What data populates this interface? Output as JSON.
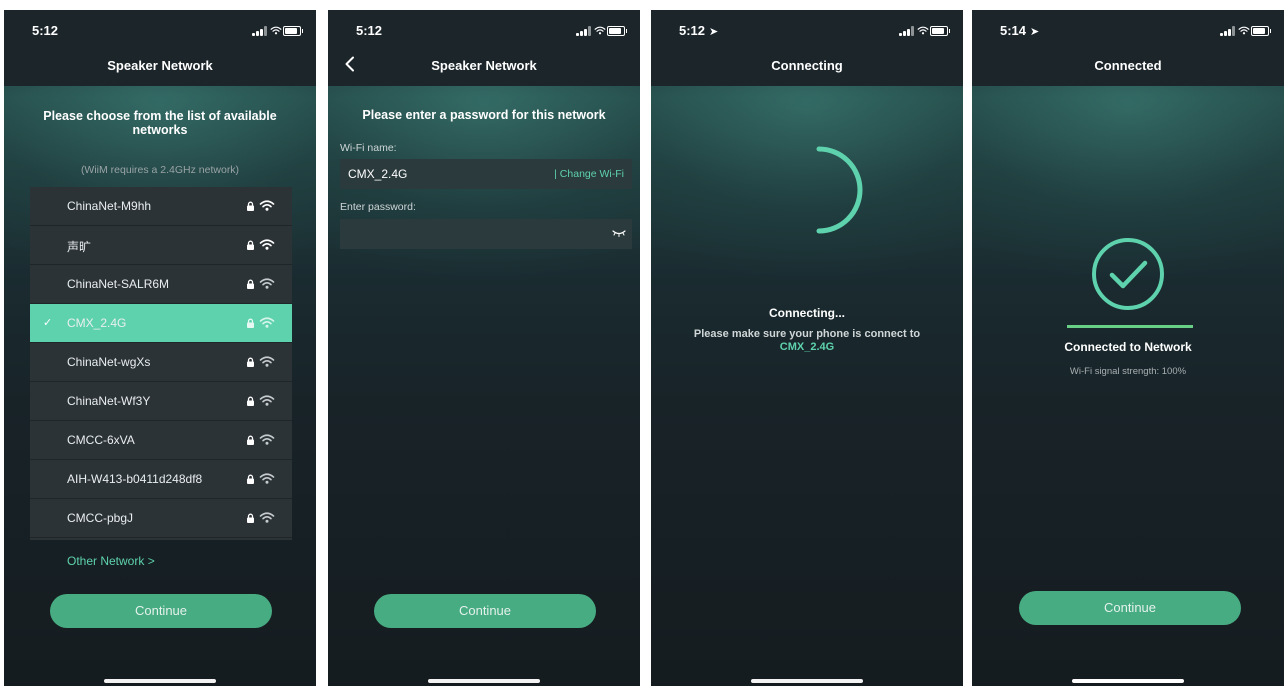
{
  "colors": {
    "accent": "#5ed2ad",
    "button": "#47ac82",
    "list_background": "#2c3337",
    "selected_row": "#5ed2ad",
    "header": "#1b252a",
    "progress": "#69cf86"
  },
  "screen1": {
    "time": "5:12",
    "title": "Speaker Network",
    "instruction": "Please choose from the list of available networks",
    "requirement_note": "(WiiM requires a 2.4GHz network)",
    "networks": [
      {
        "name": "ChinaNet-M9hh",
        "secured": true,
        "selected": false
      },
      {
        "name": "声旷",
        "secured": true,
        "selected": false
      },
      {
        "name": "ChinaNet-SALR6M",
        "secured": true,
        "selected": false
      },
      {
        "name": "CMX_2.4G",
        "secured": true,
        "selected": true
      },
      {
        "name": "ChinaNet-wgXs",
        "secured": true,
        "selected": false
      },
      {
        "name": "ChinaNet-Wf3Y",
        "secured": true,
        "selected": false
      },
      {
        "name": "CMCC-6xVA",
        "secured": true,
        "selected": false
      },
      {
        "name": "AIH-W413-b0411d248df8",
        "secured": true,
        "selected": false
      },
      {
        "name": "CMCC-pbgJ",
        "secured": true,
        "selected": false
      }
    ],
    "selected_mark": "✓",
    "other_network": "Other Network >",
    "continue_label": "Continue"
  },
  "screen2": {
    "time": "5:12",
    "title": "Speaker Network",
    "instruction": "Please enter a password for this network",
    "wifi_name_label": "Wi-Fi name:",
    "wifi_name_value": "CMX_2.4G",
    "change_wifi": "| Change Wi-Fi",
    "password_label": "Enter password:",
    "password_value": "",
    "continue_label": "Continue"
  },
  "screen3": {
    "time": "5:12",
    "title": "Connecting",
    "status": "Connecting...",
    "hint": "Please make sure your phone is connect to",
    "network_name": "CMX_2.4G"
  },
  "screen4": {
    "time": "5:14",
    "title": "Connected",
    "status": "Connected to Network",
    "signal_strength": "Wi-Fi signal strength: 100%",
    "signal_progress": 1.0,
    "continue_label": "Continue"
  }
}
